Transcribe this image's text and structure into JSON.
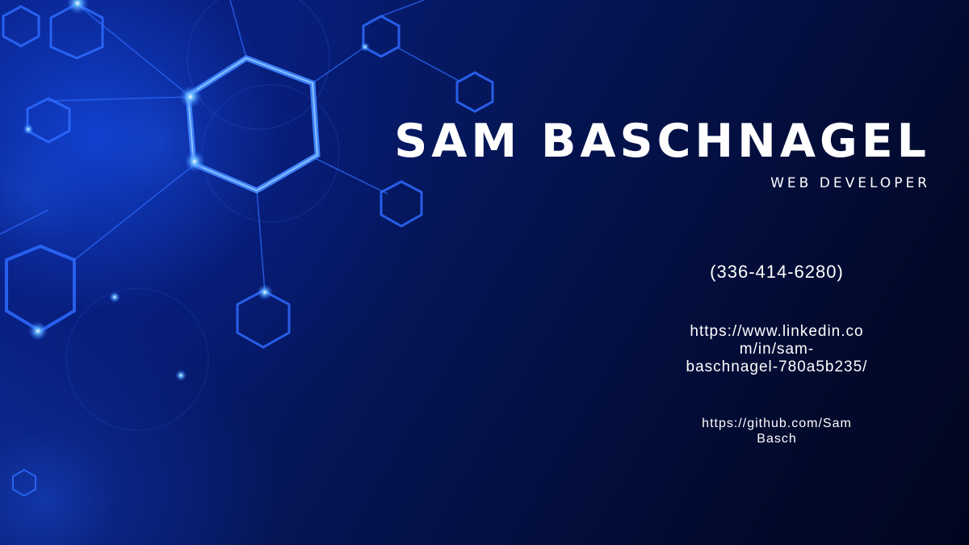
{
  "card": {
    "name": "SAM BASCHNAGEL",
    "role": "WEB DEVELOPER",
    "phone": "(336-414-6280)",
    "linkedin": "https://www.linkedin.com/in/sam-baschnagel-780a5b235/",
    "linkedin_lines": [
      "https://www.linkedin.co",
      "m/in/sam-",
      "baschnagel-780a5b235/"
    ],
    "github": "https://github.com/SamBasch",
    "github_lines": [
      "https://github.com/Sam",
      "Basch"
    ]
  },
  "background": {
    "description_icon": "hexagon-network-graphic",
    "accent_color": "#1e5bff",
    "glow_color": "#4da6ff",
    "base_color": "#020a2e"
  }
}
